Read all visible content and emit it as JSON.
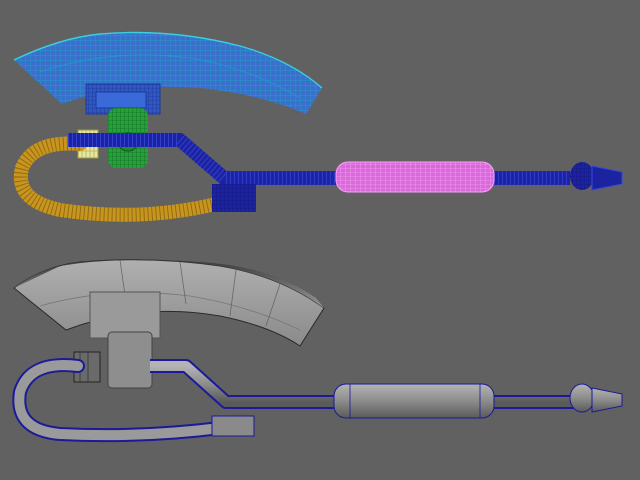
{
  "viewport": {
    "background_color": "#616161",
    "panels": [
      {
        "mode": "wireframe-on-shaded",
        "parts": [
          {
            "name": "blade",
            "color": "#3a70cc",
            "wire_color": "#2a9fb0"
          },
          {
            "name": "blade-mount",
            "color": "#2e58c0"
          },
          {
            "name": "green-block",
            "color": "#26a03c"
          },
          {
            "name": "cable",
            "color": "#c8961e"
          },
          {
            "name": "shaft",
            "color": "#1c23a0"
          },
          {
            "name": "selected-grip",
            "color": "#d96ad9"
          },
          {
            "name": "cuff",
            "color": "#e6e6a0"
          }
        ]
      },
      {
        "mode": "smooth-shaded-with-edges",
        "parts": [
          {
            "name": "blade",
            "color": "#9a9a9a"
          },
          {
            "name": "shaft",
            "color": "#8c8c8c",
            "wire_color": "#1a1a9a"
          }
        ]
      }
    ],
    "icons": [
      "axe-model-icon",
      "axe-model-icon"
    ]
  }
}
